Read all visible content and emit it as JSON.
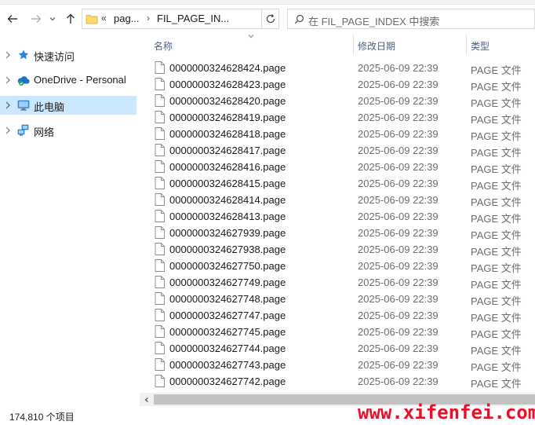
{
  "address_bar": {
    "overflow_marker": "«",
    "crumbs": [
      "pag...",
      "FIL_PAGE_IN..."
    ]
  },
  "search": {
    "placeholder": "在 FIL_PAGE_INDEX 中搜索"
  },
  "nav_pane": {
    "items": [
      {
        "label": "快速访问",
        "icon": "quick-access-star-icon",
        "selected": false
      },
      {
        "label": "OneDrive - Personal",
        "icon": "onedrive-cloud-icon",
        "selected": false
      },
      {
        "label": "此电脑",
        "icon": "this-pc-monitor-icon",
        "selected": true
      },
      {
        "label": "网络",
        "icon": "network-icon",
        "selected": false
      }
    ]
  },
  "columns": {
    "name": "名称",
    "modified": "修改日期",
    "type": "类型"
  },
  "files": [
    {
      "name": "0000000324628424.page",
      "modified": "2025-06-09 22:39",
      "type": "PAGE 文件"
    },
    {
      "name": "0000000324628423.page",
      "modified": "2025-06-09 22:39",
      "type": "PAGE 文件"
    },
    {
      "name": "0000000324628420.page",
      "modified": "2025-06-09 22:39",
      "type": "PAGE 文件"
    },
    {
      "name": "0000000324628419.page",
      "modified": "2025-06-09 22:39",
      "type": "PAGE 文件"
    },
    {
      "name": "0000000324628418.page",
      "modified": "2025-06-09 22:39",
      "type": "PAGE 文件"
    },
    {
      "name": "0000000324628417.page",
      "modified": "2025-06-09 22:39",
      "type": "PAGE 文件"
    },
    {
      "name": "0000000324628416.page",
      "modified": "2025-06-09 22:39",
      "type": "PAGE 文件"
    },
    {
      "name": "0000000324628415.page",
      "modified": "2025-06-09 22:39",
      "type": "PAGE 文件"
    },
    {
      "name": "0000000324628414.page",
      "modified": "2025-06-09 22:39",
      "type": "PAGE 文件"
    },
    {
      "name": "0000000324628413.page",
      "modified": "2025-06-09 22:39",
      "type": "PAGE 文件"
    },
    {
      "name": "0000000324627939.page",
      "modified": "2025-06-09 22:39",
      "type": "PAGE 文件"
    },
    {
      "name": "0000000324627938.page",
      "modified": "2025-06-09 22:39",
      "type": "PAGE 文件"
    },
    {
      "name": "0000000324627750.page",
      "modified": "2025-06-09 22:39",
      "type": "PAGE 文件"
    },
    {
      "name": "0000000324627749.page",
      "modified": "2025-06-09 22:39",
      "type": "PAGE 文件"
    },
    {
      "name": "0000000324627748.page",
      "modified": "2025-06-09 22:39",
      "type": "PAGE 文件"
    },
    {
      "name": "0000000324627747.page",
      "modified": "2025-06-09 22:39",
      "type": "PAGE 文件"
    },
    {
      "name": "0000000324627745.page",
      "modified": "2025-06-09 22:39",
      "type": "PAGE 文件"
    },
    {
      "name": "0000000324627744.page",
      "modified": "2025-06-09 22:39",
      "type": "PAGE 文件"
    },
    {
      "name": "0000000324627743.page",
      "modified": "2025-06-09 22:39",
      "type": "PAGE 文件"
    },
    {
      "name": "0000000324627742.page",
      "modified": "2025-06-09 22:39",
      "type": "PAGE 文件"
    }
  ],
  "status_bar": {
    "item_count": "174,810 个项目"
  },
  "watermark": {
    "text": "www.xifenfei.com",
    "color": "#e8102a"
  },
  "colors": {
    "selection": "#cce8ff",
    "header_text": "#4c607a",
    "muted_text": "#6d6d6d"
  }
}
